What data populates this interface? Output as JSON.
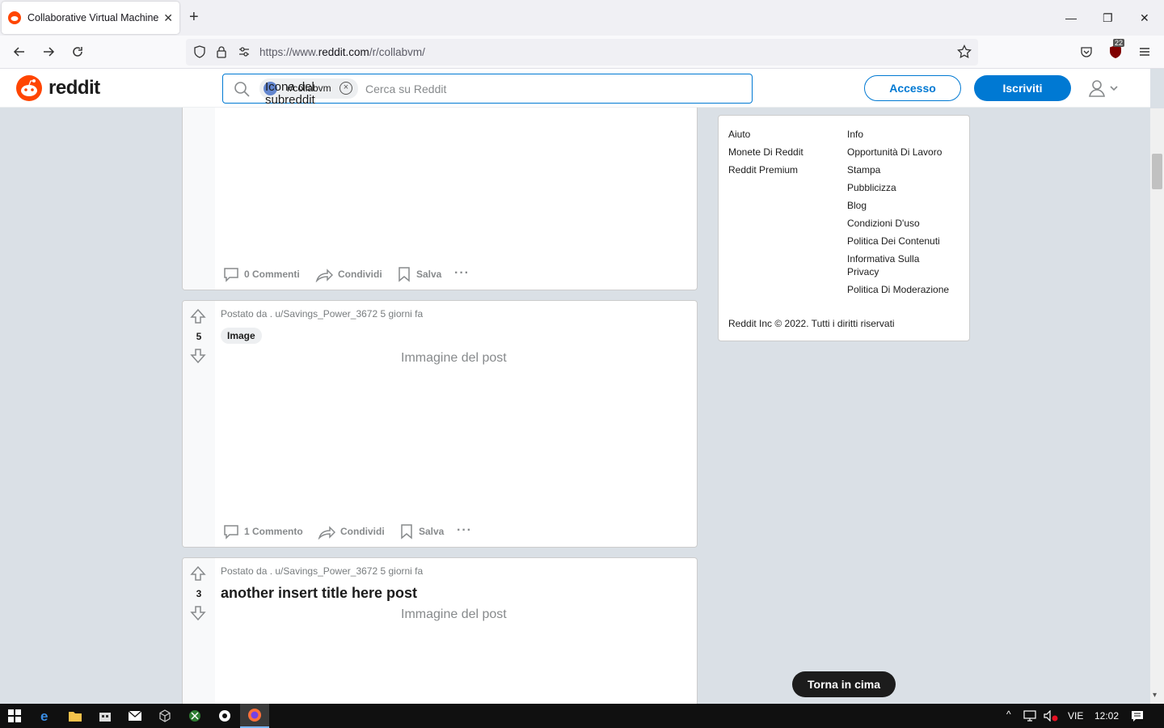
{
  "browser": {
    "tab_title": "Collaborative Virtual Machines!",
    "url_prefix": "https://www.",
    "url_domain": "reddit.com",
    "url_path": "/r/collabvm/",
    "extension_badge": "22"
  },
  "header": {
    "wordmark": "reddit",
    "search_chip": "r/collabvm",
    "search_placeholder": "Cerca su Reddit",
    "tooltip": "Icona del subreddit",
    "login_label": "Accesso",
    "signup_label": "Iscriviti"
  },
  "posts": [
    {
      "comments_label": "0 Commenti",
      "share_label": "Condividi",
      "save_label": "Salva"
    },
    {
      "votes": "5",
      "meta": "Postato da . u/Savings_Power_3672 5 giorni fa",
      "flair": "Image",
      "image_alt": "Immagine del post",
      "comments_label": "1 Commento",
      "share_label": "Condividi",
      "save_label": "Salva"
    },
    {
      "votes": "3",
      "meta": "Postato da . u/Savings_Power_3672 5 giorni fa",
      "title": "another insert title here post",
      "image_alt": "Immagine del post"
    }
  ],
  "sidebar": {
    "col1": [
      "Aiuto",
      "Monete Di Reddit",
      "Reddit Premium"
    ],
    "col2": [
      "Info",
      "Opportunità Di Lavoro",
      "Stampa",
      "Pubblicizza",
      "Blog",
      "Condizioni D'uso",
      "Politica Dei Contenuti",
      "Informativa Sulla Privacy",
      "Politica Di Moderazione"
    ],
    "copyright": "Reddit Inc © 2022. Tutti i diritti riservati"
  },
  "back_to_top": "Torna in cima",
  "taskbar": {
    "language": "VIE",
    "clock": "12:02"
  },
  "colors": {
    "reddit_orange": "#ff4500",
    "reddit_blue": "#0079d3",
    "page_bg": "#dae0e6"
  }
}
